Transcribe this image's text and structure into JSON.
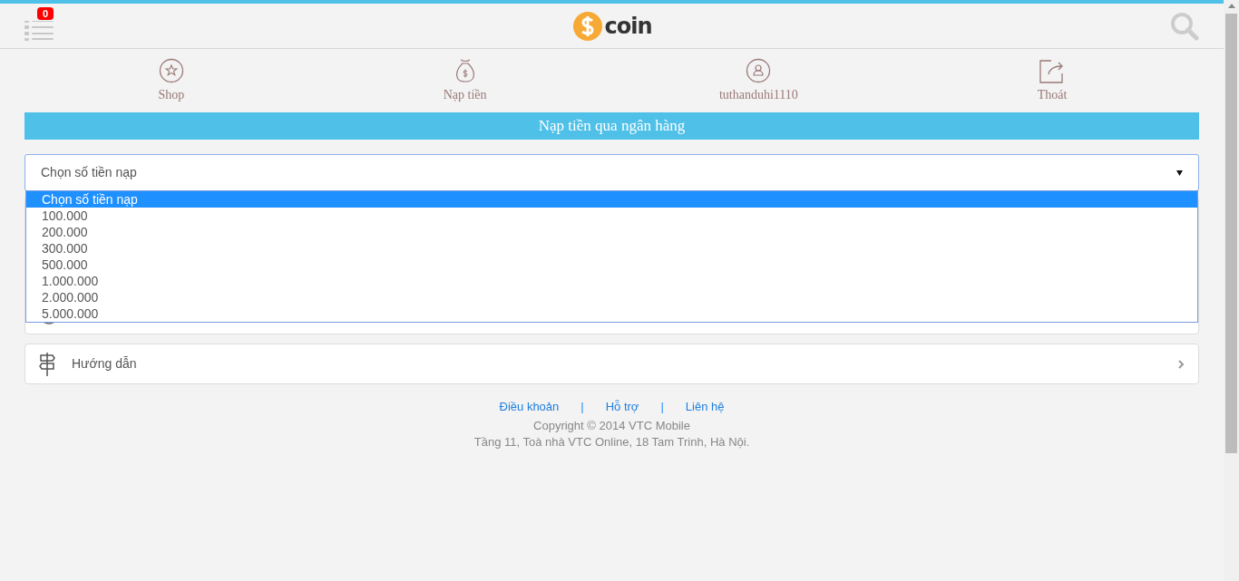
{
  "header": {
    "badge": "0",
    "logo_text": "coin"
  },
  "nav": [
    {
      "kind": "star",
      "label": "Shop"
    },
    {
      "kind": "bag",
      "label": "Nạp tiền"
    },
    {
      "kind": "user",
      "label": "tuthanduhi1110"
    },
    {
      "kind": "exit",
      "label": "Thoát"
    }
  ],
  "section_title": "Nạp tiền qua ngân hàng",
  "select": {
    "value": "Chọn số tiền nạp",
    "expanded": true,
    "options": [
      {
        "label": "Chọn số tiền nạp",
        "selected": true
      },
      {
        "label": "100.000",
        "selected": false
      },
      {
        "label": "200.000",
        "selected": false
      },
      {
        "label": "300.000",
        "selected": false
      },
      {
        "label": "500.000",
        "selected": false
      },
      {
        "label": "1.000.000",
        "selected": false
      },
      {
        "label": "2.000.000",
        "selected": false
      },
      {
        "label": "5.000.000",
        "selected": false
      }
    ]
  },
  "guide": {
    "label": "Hướng dẫn"
  },
  "footer": {
    "separator": "|",
    "links": [
      "Điều khoản",
      "Hỗ trợ",
      "Liên hệ"
    ],
    "copyright": "Copyright © 2014 VTC Mobile",
    "address": "Tầng 11, Toà nhà VTC Online, 18 Tam Trinh, Hà Nội."
  }
}
